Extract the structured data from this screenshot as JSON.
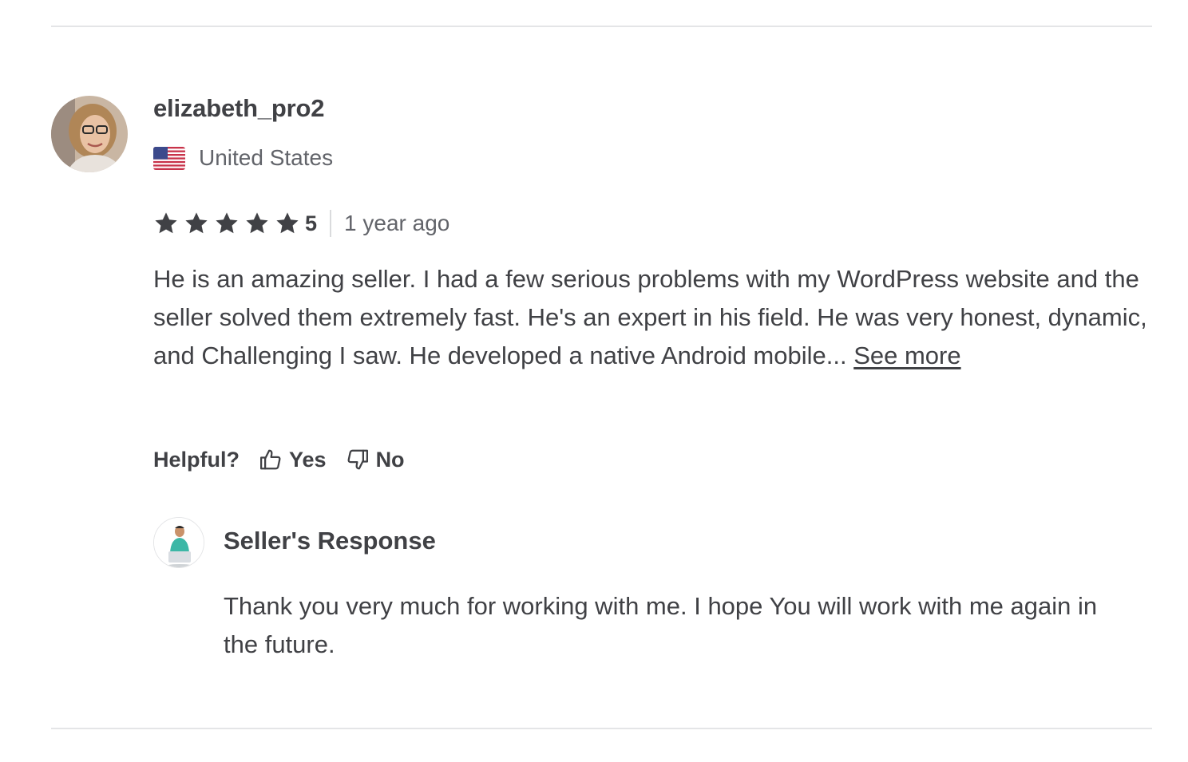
{
  "review": {
    "username": "elizabeth_pro2",
    "country": "United States",
    "flag_icon": "us-flag-icon",
    "rating": 5,
    "rating_text": "5",
    "time_ago": "1 year ago",
    "text": "He is an amazing seller. I had a few serious problems with my WordPress website and the seller solved them extremely fast. He's an expert in his field. He was very honest, dynamic, and Challenging I saw. He developed a native Android mobile...",
    "see_more_label": "See more",
    "star_color": "#404145"
  },
  "helpful": {
    "label": "Helpful?",
    "yes_label": "Yes",
    "no_label": "No",
    "yes_icon": "thumbs-up-icon",
    "no_icon": "thumbs-down-icon"
  },
  "seller_response": {
    "title": "Seller's Response",
    "text": "Thank you very much for working with me. I hope You will work with me again in the future."
  }
}
